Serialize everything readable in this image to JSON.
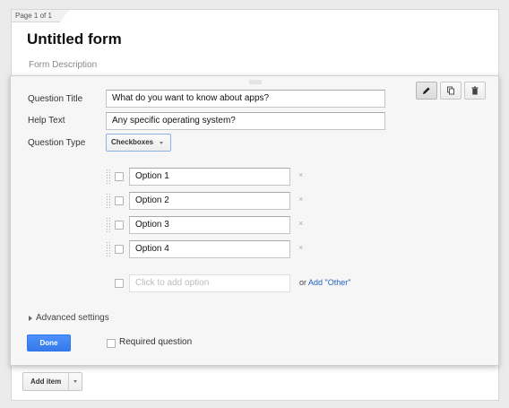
{
  "page": {
    "indicator": "Page 1 of 1"
  },
  "form": {
    "title": "Untitled form",
    "description": "Form Description"
  },
  "toolbar": {
    "items": [
      {
        "name": "edit",
        "icon": "pencil-icon",
        "active": true
      },
      {
        "name": "duplicate",
        "icon": "copy-icon",
        "active": false
      },
      {
        "name": "delete",
        "icon": "trash-icon",
        "active": false
      }
    ]
  },
  "question": {
    "title_label": "Question Title",
    "title_value": "What do you want to know about apps?",
    "help_label": "Help Text",
    "help_value": "Any specific operating system?",
    "type_label": "Question Type",
    "type_value": "Checkboxes"
  },
  "options": {
    "items": [
      "Option 1",
      "Option 2",
      "Option 3",
      "Option 4"
    ],
    "remove_symbol": "×",
    "add_placeholder": "Click to add option",
    "or_text": "or",
    "add_other": "Add \"Other\""
  },
  "advanced": {
    "label": "Advanced settings"
  },
  "actions": {
    "done_label": "Done",
    "required_label": "Required question"
  },
  "add_item": {
    "label": "Add item"
  },
  "colors": {
    "primary_blue": "#4d90fe",
    "link_blue": "#2163c6"
  }
}
